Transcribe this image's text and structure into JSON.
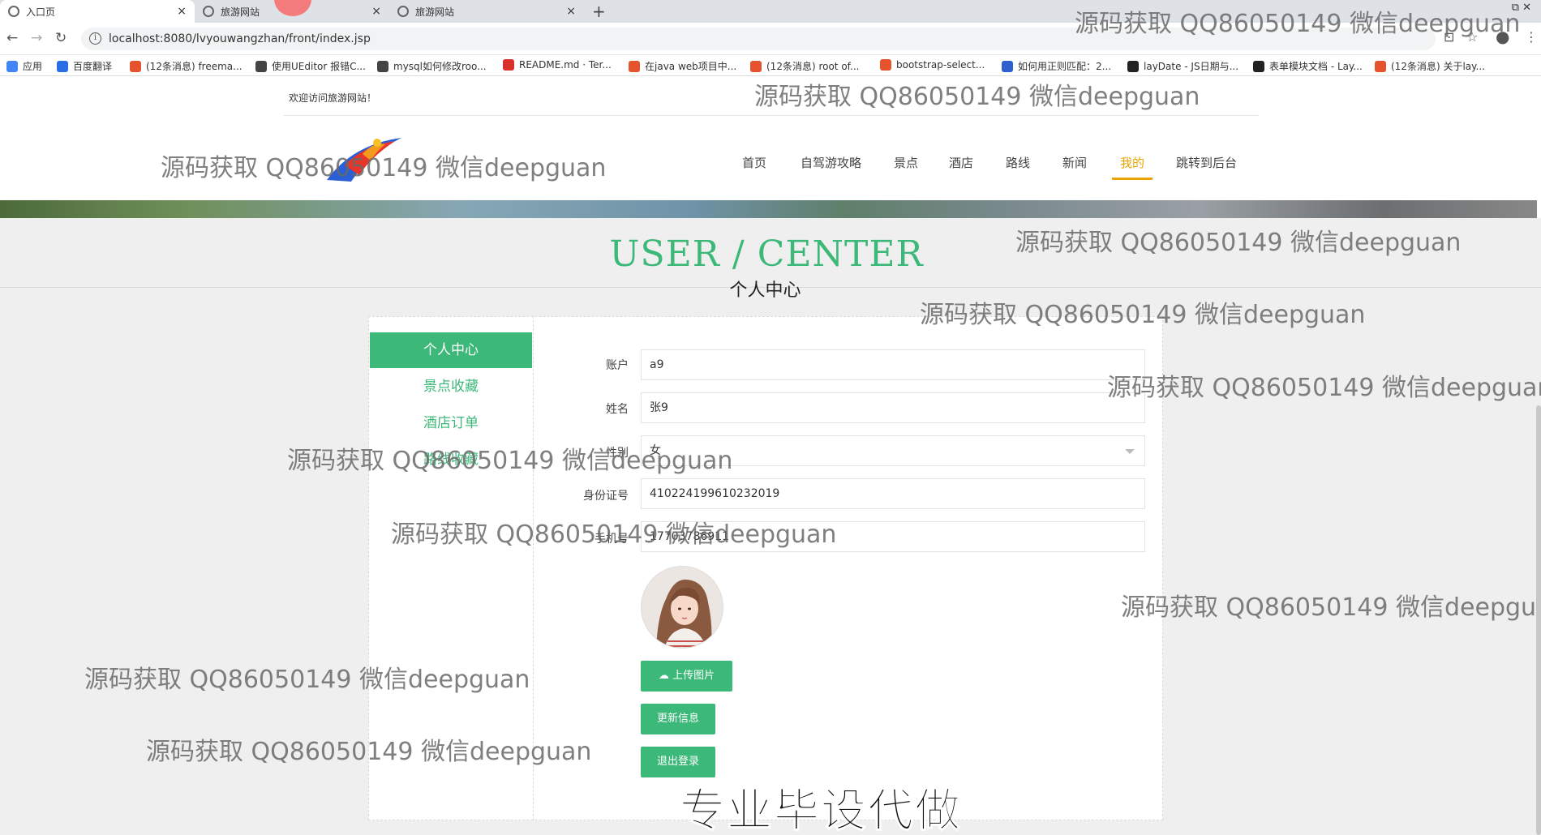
{
  "browser": {
    "tabs": [
      {
        "label": "入口页",
        "close": "×"
      },
      {
        "label": "旅游网站",
        "close": "×"
      },
      {
        "label": "旅游网站",
        "close": "×"
      }
    ],
    "new_tab": "+",
    "window_controls": "⧉ ✕",
    "url": "localhost:8080/lvyouwangzhan/front/index.jsp",
    "bookmarks": [
      {
        "label": "应用",
        "color": "#4285f4"
      },
      {
        "label": "百度翻译",
        "color": "#2b6de5"
      },
      {
        "label": "(12条消息) freema...",
        "color": "#e5532d"
      },
      {
        "label": "使用UEditor 报错C...",
        "color": "#444444"
      },
      {
        "label": "mysql如何修改roo...",
        "color": "#444444"
      },
      {
        "label": "README.md · Ter...",
        "color": "#d9302c"
      },
      {
        "label": "在java web项目中...",
        "color": "#e5532d"
      },
      {
        "label": "(12条消息) root of...",
        "color": "#e5532d"
      },
      {
        "label": "bootstrap-select...",
        "color": "#e5532d"
      },
      {
        "label": "如何用正则匹配：2...",
        "color": "#3060d0"
      },
      {
        "label": "layDate - JS日期与...",
        "color": "#222222"
      },
      {
        "label": "表单模块文档 - Lay...",
        "color": "#222222"
      },
      {
        "label": "(12条消息) 关于lay...",
        "color": "#e5532d"
      }
    ]
  },
  "header": {
    "welcome": "欢迎访问旅游网站！",
    "nav": [
      "首页",
      "自驾游攻略",
      "景点",
      "酒店",
      "路线",
      "新闻",
      "我的",
      "跳转到后台"
    ],
    "active_nav": "我的"
  },
  "user_center": {
    "title": "USER / CENTER",
    "subtitle": "个人中心",
    "sidebar": [
      "个人中心",
      "景点收藏",
      "酒店订单",
      "路线收藏"
    ],
    "fields": [
      {
        "label": "账户",
        "value": "a9"
      },
      {
        "label": "姓名",
        "value": "张9"
      },
      {
        "label": "性别",
        "value": "女"
      },
      {
        "label": "身份证号",
        "value": "410224199610232019"
      },
      {
        "label": "手机号",
        "value": "17703786911"
      }
    ],
    "upload_button": "上传图片",
    "update_button": "更新信息",
    "logout_button": "退出登录"
  },
  "overlay": {
    "watermark": "源码获取 QQ86050149 微信deepguan",
    "watermark_clipped": "源码获取 QQ86050149 微信deepgua",
    "stamp": "专业毕设代做"
  },
  "colors": {
    "accent": "#3cb878",
    "active_nav": "#e8a400"
  }
}
